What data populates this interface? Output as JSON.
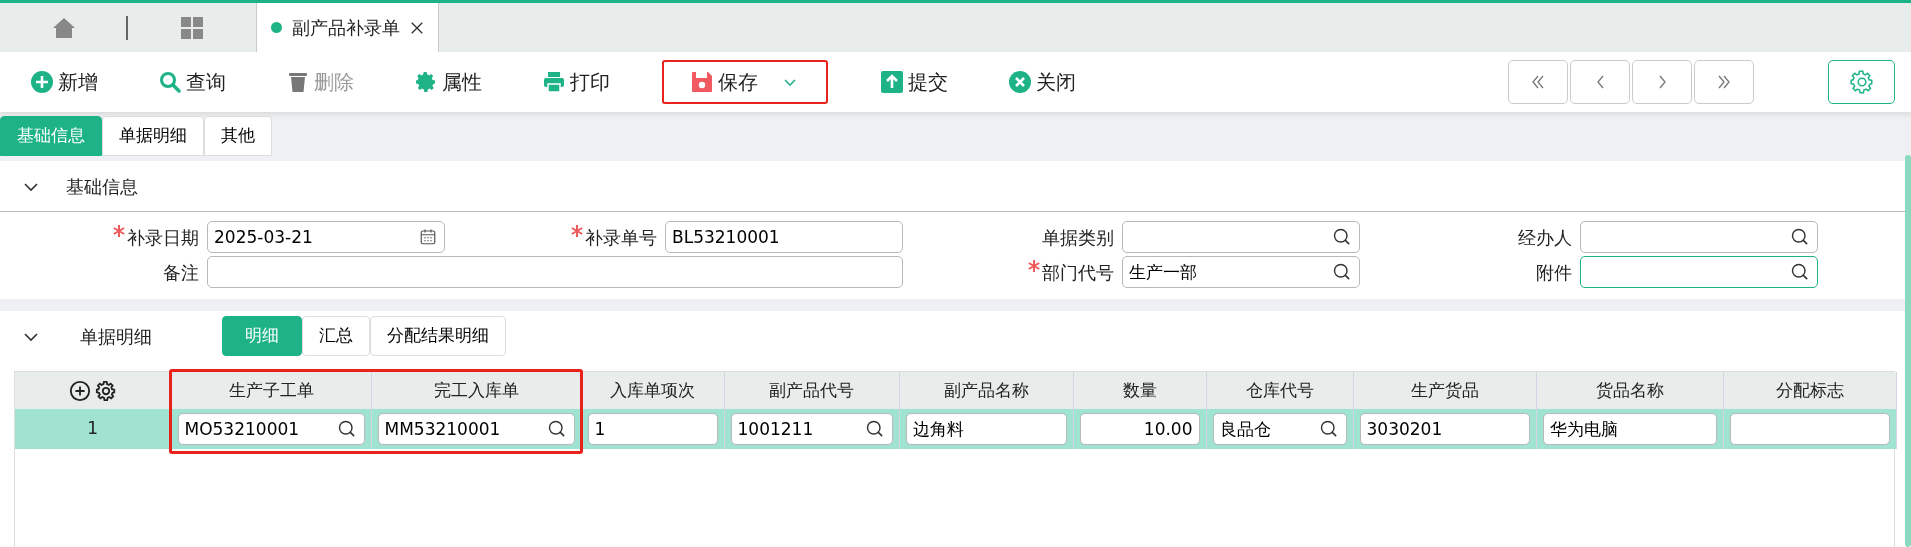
{
  "tabs": [
    {
      "kind": "home",
      "selected": false
    },
    {
      "kind": "apps",
      "selected": false
    },
    {
      "kind": "document",
      "label": "副产品补录单",
      "selected": true
    }
  ],
  "toolbar": [
    {
      "kind": "add",
      "label": "新增",
      "disabled": false,
      "highlighted": false
    },
    {
      "kind": "search",
      "label": "查询",
      "disabled": false,
      "highlighted": false
    },
    {
      "kind": "delete",
      "label": "删除",
      "disabled": true,
      "highlighted": false
    },
    {
      "kind": "settings",
      "label": "属性",
      "disabled": false,
      "highlighted": false
    },
    {
      "kind": "print",
      "label": "打印",
      "disabled": false,
      "highlighted": false
    },
    {
      "kind": "save",
      "label": "保存",
      "disabled": false,
      "highlighted": true
    },
    {
      "kind": "submit",
      "label": "提交",
      "disabled": false,
      "highlighted": false
    },
    {
      "kind": "close",
      "label": "关闭",
      "disabled": false,
      "highlighted": false
    }
  ],
  "pager": [
    {
      "kind": "first"
    },
    {
      "kind": "previous"
    },
    {
      "kind": "next"
    },
    {
      "kind": "last"
    }
  ],
  "page_tabs": [
    {
      "label": "基础信息",
      "selected": true
    },
    {
      "label": "单据明细",
      "selected": false
    },
    {
      "label": "其他",
      "selected": false
    }
  ],
  "basic": {
    "title": "基础信息",
    "expanded": true,
    "fields": [
      {
        "label": "补录日期",
        "required": true,
        "kind": "date",
        "value": "2025-03-21",
        "focused": false
      },
      {
        "label": "补录单号",
        "required": true,
        "kind": "text",
        "value": "BL53210001",
        "focused": false
      },
      {
        "label": "单据类别",
        "required": false,
        "kind": "lookup",
        "focused": false
      },
      {
        "label": "经办人",
        "required": false,
        "kind": "lookup",
        "focused": false
      },
      {
        "label": "备注",
        "required": false,
        "kind": "memo",
        "focused": false
      },
      {
        "label": "部门代号",
        "required": true,
        "kind": "lookup",
        "value": "生产一部",
        "focused": false
      },
      {
        "label": "附件",
        "required": false,
        "kind": "lookup",
        "focused": true
      }
    ]
  },
  "detail": {
    "title": "单据明细",
    "expanded": true,
    "tabs": [
      {
        "label": "明细",
        "selected": true
      },
      {
        "label": "汇总",
        "selected": false
      },
      {
        "label": "分配结果明细",
        "selected": false
      }
    ],
    "table": {
      "columns": [
        {
          "kind": "tools",
          "highlighted": false
        },
        {
          "label": "生产子工单",
          "highlighted": true
        },
        {
          "label": "完工入库单",
          "highlighted": true
        },
        {
          "label": "入库单项次",
          "highlighted": false
        },
        {
          "label": "副产品代号",
          "highlighted": false
        },
        {
          "label": "副产品名称",
          "highlighted": false
        },
        {
          "label": "数量",
          "highlighted": false
        },
        {
          "label": "仓库代号",
          "highlighted": false
        },
        {
          "label": "生产货品",
          "highlighted": false
        },
        {
          "label": "货品名称",
          "highlighted": false
        },
        {
          "label": "分配标志",
          "highlighted": false
        }
      ],
      "rows": [
        {
          "selected": true,
          "cells": [
            {
              "kind": "index",
              "value": "1"
            },
            {
              "kind": "lookup",
              "value": "MO53210001"
            },
            {
              "kind": "lookup",
              "value": "MM53210001"
            },
            {
              "kind": "text",
              "value": "1"
            },
            {
              "kind": "lookup",
              "value": "1001211"
            },
            {
              "kind": "text",
              "value": "边角料"
            },
            {
              "kind": "number",
              "value": "10.00"
            },
            {
              "kind": "lookup",
              "value": "良品仓"
            },
            {
              "kind": "text",
              "value": "3030201"
            },
            {
              "kind": "text",
              "value": "华为电脑"
            },
            {
              "kind": "text"
            }
          ]
        }
      ]
    }
  }
}
